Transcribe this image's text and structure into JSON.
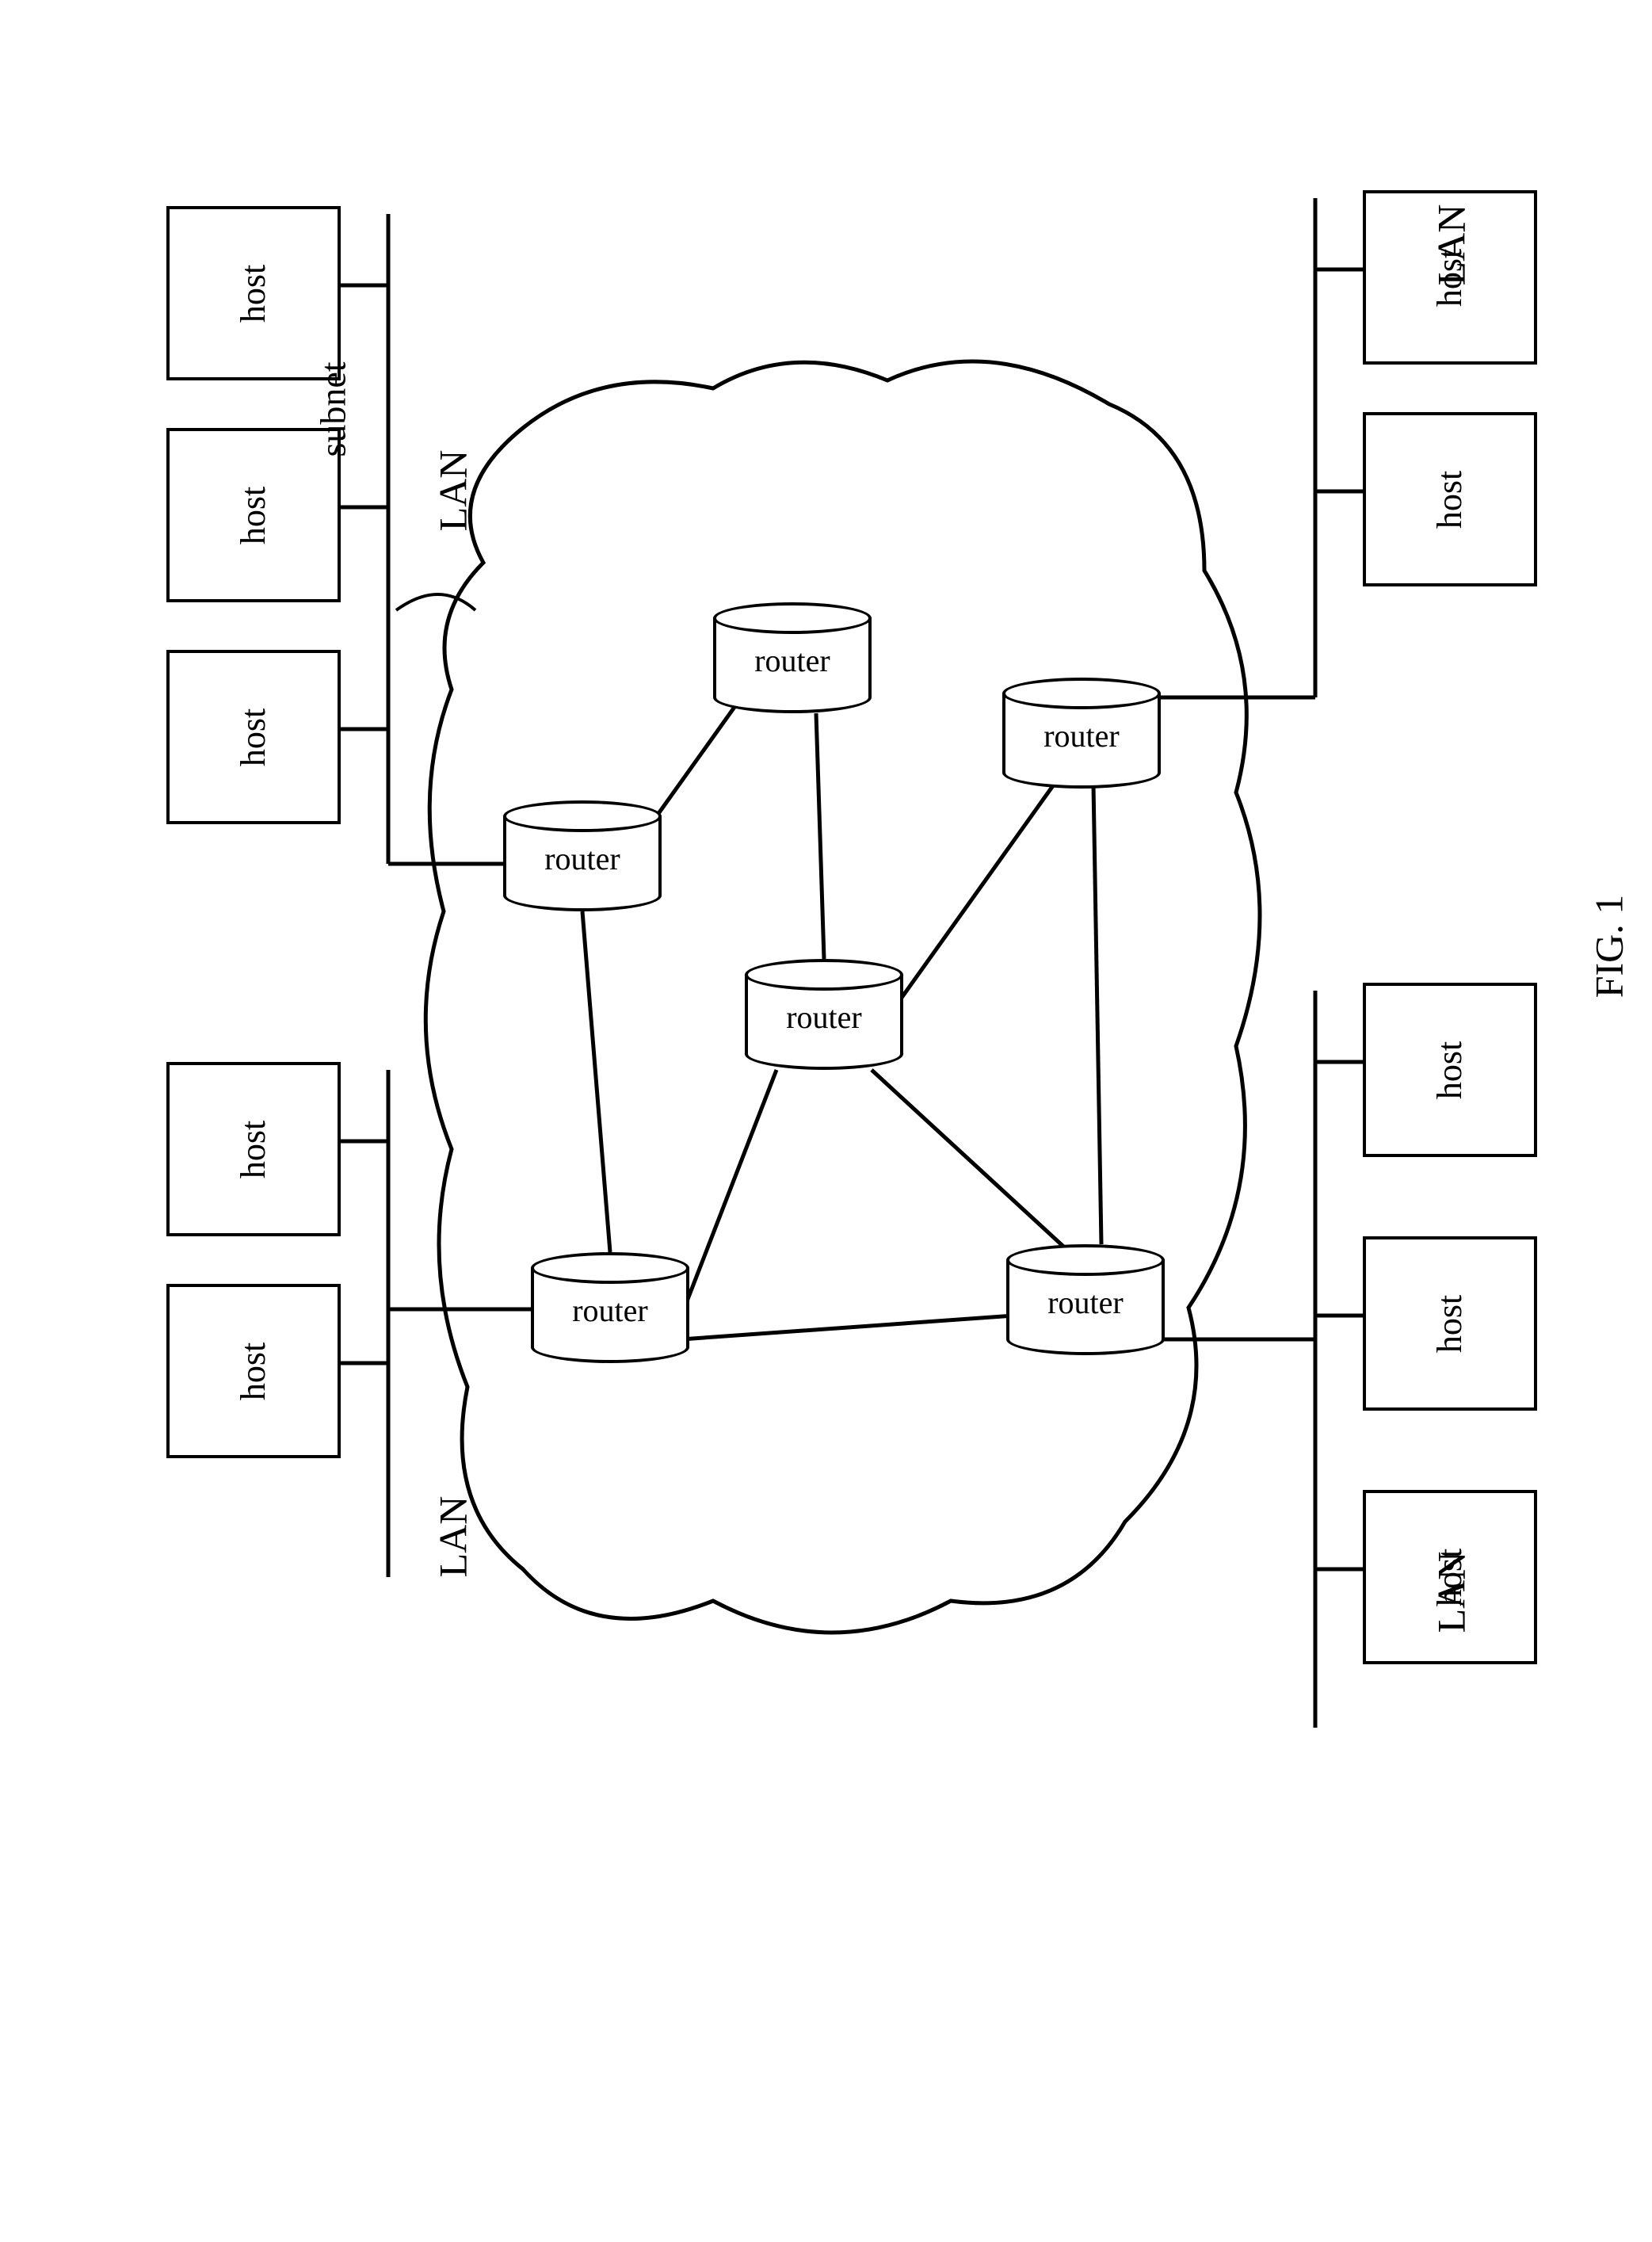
{
  "hosts": {
    "label": "host"
  },
  "routers": {
    "label": "router"
  },
  "lan_labels": {
    "top_left": "LAN",
    "top_right": "LAN",
    "bottom_left": "LAN",
    "bottom_right": "LAN"
  },
  "subnet_label": "subnet",
  "figure_caption": "FIG. 1",
  "chart_data": {
    "type": "network_diagram",
    "description": "Network topology showing four LANs connected through a subnet of six interconnected routers",
    "lans": [
      {
        "id": "lan1",
        "position": "top-left",
        "hosts": 3
      },
      {
        "id": "lan2",
        "position": "top-right",
        "hosts": 2
      },
      {
        "id": "lan3",
        "position": "bottom-left",
        "hosts": 2
      },
      {
        "id": "lan4",
        "position": "bottom-right",
        "hosts": 3
      }
    ],
    "subnet": {
      "routers": 6,
      "connections": [
        [
          "r1",
          "r2"
        ],
        [
          "r1",
          "r3"
        ],
        [
          "r2",
          "r4"
        ],
        [
          "r3",
          "r4"
        ],
        [
          "r3",
          "r5"
        ],
        [
          "r4",
          "r5"
        ],
        [
          "r4",
          "r6"
        ],
        [
          "r5",
          "r6"
        ]
      ],
      "lan_connections": [
        {
          "lan": "lan1",
          "router": "r1"
        },
        {
          "lan": "lan2",
          "router": "r2"
        },
        {
          "lan": "lan3",
          "router": "r5"
        },
        {
          "lan": "lan4",
          "router": "r6"
        }
      ]
    }
  }
}
